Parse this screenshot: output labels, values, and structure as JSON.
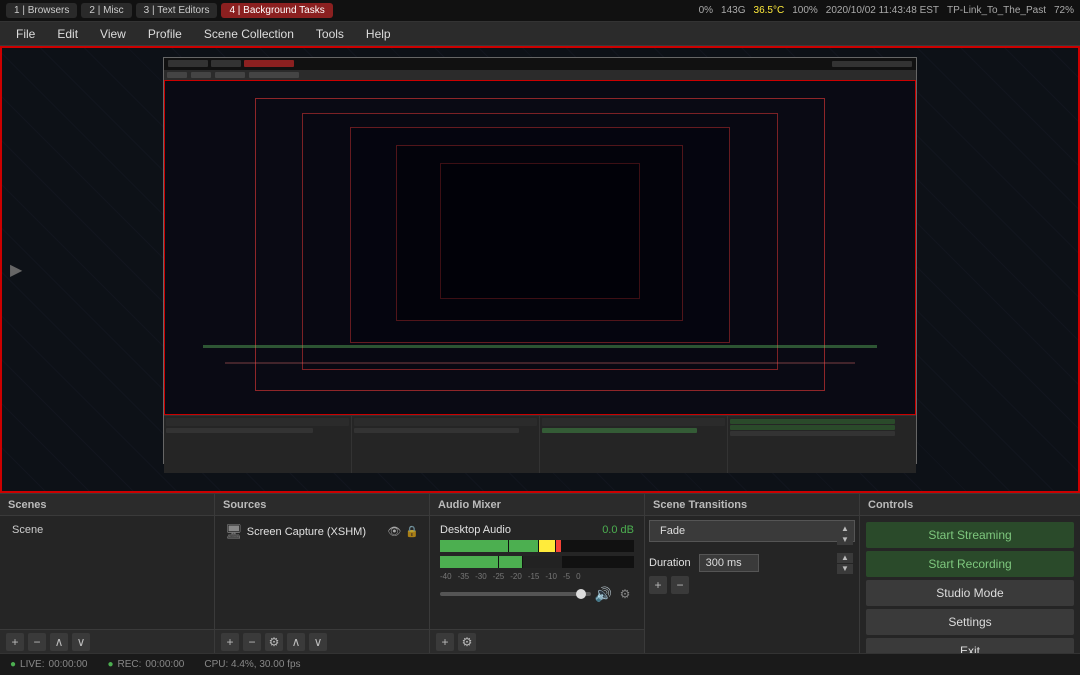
{
  "system_bar": {
    "tabs": [
      {
        "label": "1 | Browsers",
        "active": false
      },
      {
        "label": "2 | Misc",
        "active": false
      },
      {
        "label": "3 | Text Editors",
        "active": false
      },
      {
        "label": "4 | Background Tasks",
        "active": true
      }
    ],
    "cpu": "0%",
    "mem": "143G",
    "temp": "36.5°C",
    "battery": "100%",
    "datetime": "2020/10/02  11:43:48 EST",
    "network": "TP-Link_To_The_Past",
    "brightness": "72%"
  },
  "menu_bar": {
    "items": [
      "File",
      "Edit",
      "View",
      "Profile",
      "Scene Collection",
      "Tools",
      "Help"
    ]
  },
  "panels": {
    "scenes": {
      "header": "Scenes",
      "items": [
        "Scene"
      ]
    },
    "sources": {
      "header": "Sources",
      "items": [
        {
          "label": "Screen Capture (XSHM)",
          "visible": true,
          "locked": true
        }
      ]
    },
    "audio_mixer": {
      "header": "Audio Mixer",
      "track": {
        "name": "Desktop Audio",
        "volume_db": "0.0 dB",
        "labels": [
          "-40",
          "-35",
          "-30",
          "-25",
          "-20",
          "-15",
          "-10",
          "-5",
          "0"
        ]
      }
    },
    "scene_transitions": {
      "header": "Scene Transitions",
      "transition": "Fade",
      "duration_label": "Duration",
      "duration_value": "300 ms"
    },
    "controls": {
      "header": "Controls",
      "buttons": {
        "start_streaming": "Start Streaming",
        "start_recording": "Start Recording",
        "studio_mode": "Studio Mode",
        "settings": "Settings",
        "exit": "Exit"
      }
    }
  },
  "status_bar": {
    "live_label": "LIVE:",
    "live_time": "00:00:00",
    "rec_label": "REC:",
    "rec_time": "00:00:00",
    "cpu_label": "CPU: 4.4%, 30.00 fps"
  },
  "toolbar": {
    "add": "+",
    "remove": "−",
    "up": "∧",
    "down": "∨",
    "settings_icon": "⚙"
  }
}
